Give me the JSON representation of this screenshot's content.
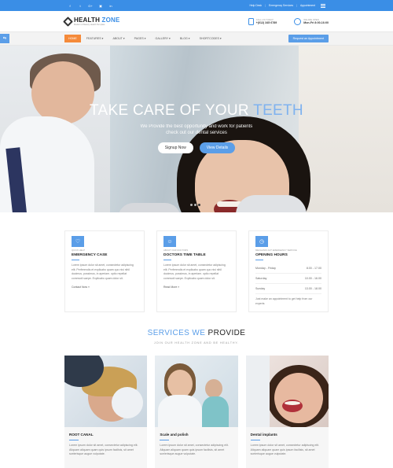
{
  "topbar": {
    "social": [
      "f",
      "t",
      "G+",
      "▣",
      "in"
    ],
    "links": [
      "Help Desk",
      "Emergency Services",
      "Appointment"
    ]
  },
  "header": {
    "logo_name_1": "HEALTH",
    "logo_name_2": "ZONE",
    "logo_tagline": "Modern & Beauty Health Template",
    "call_label": "CALL US TODAY!",
    "call_value": "+(012) 345 6789",
    "open_label": "WE ARE OPEN",
    "open_value": "Mon-Fri 8:00-16:00"
  },
  "nav": {
    "items": [
      "HOME",
      "FEATURES ▾",
      "ABOUT ▾",
      "PAGES ▾",
      "GALLERY ▾",
      "BLOG ▾",
      "SHORTCODES ▾"
    ],
    "appointment": "Request an Appointment",
    "side_tab": "⇆"
  },
  "hero": {
    "title_a": "TAKE CARE OF YOUR ",
    "title_b": "TEETH",
    "subtitle_1": "We Provide the best opportunity and work for patients",
    "subtitle_2": "check out our dental services",
    "btn_signup": "Signup Now",
    "btn_details": "View Details"
  },
  "cards": [
    {
      "icon": "♡",
      "kicker": "QUICK HELP",
      "title": "EMERGENCY CASE",
      "body": "Lorem ipsum dolor sit amet, consectetur adipiscing elit. Perferendis et explicabo quam quo nisi nihil ducimus, possimus, in aperiam. optio repellat commodi saepe. Explicabo quam dolor sit.",
      "more": "Contact Now »"
    },
    {
      "icon": "☺",
      "kicker": "ABOUT OUR DOCTORS",
      "title": "DOCTORS TIME TABLE",
      "body": "Lorem ipsum dolor sit amet, consectetur adipiscing elit. Perferendis et explicabo quam quo nisi nihil ducimus, possimus, in aperiam. optio repellat commodi saepe. Explicabo quam dolor sit.",
      "more": "Read More »"
    },
    {
      "icon": "◷",
      "kicker": "MECHANIK 24/7 EMERGENCY SERVICE",
      "title": "OPENING HOURS",
      "hours": [
        {
          "day": "Monday - Friday",
          "time": "8.00 - 17.00"
        },
        {
          "day": "Saturday",
          "time": "10.00 - 16.00"
        },
        {
          "day": "Sunday",
          "time": "13.00 - 18.00"
        }
      ],
      "note": "Just make an appointment to get help from our experts"
    }
  ],
  "services": {
    "title_a": "SERVICES WE",
    "title_b": "PROVIDE",
    "subtitle": "JOIN OUR HEALTH ZONE AND BE HEALTHY.",
    "items": [
      {
        "name": "ROOT CANAL",
        "body": "Lorem ipsum dolor sit amet, consectetur adipiscing elit. Aliquam aliquam quam quis ipsum facilisis, sit amet scelerisque augue vulputate."
      },
      {
        "name": "Scale and polish",
        "body": "Lorem ipsum dolor sit amet, consectetur adipiscing elit. Aliquam aliquam quam quis ipsum facilisis, sit amet scelerisque augue vulputate."
      },
      {
        "name": "Dental implants",
        "body": "Lorem ipsum dolor sit amet, consectetur adipiscing elit. Aliquam aliquam quam quis ipsum facilisis, sit amet scelerisque augue vulputate."
      }
    ]
  },
  "colors": {
    "brand": "#3a8ee6",
    "accent": "#f58a3a",
    "button": "#5b9ee8"
  }
}
